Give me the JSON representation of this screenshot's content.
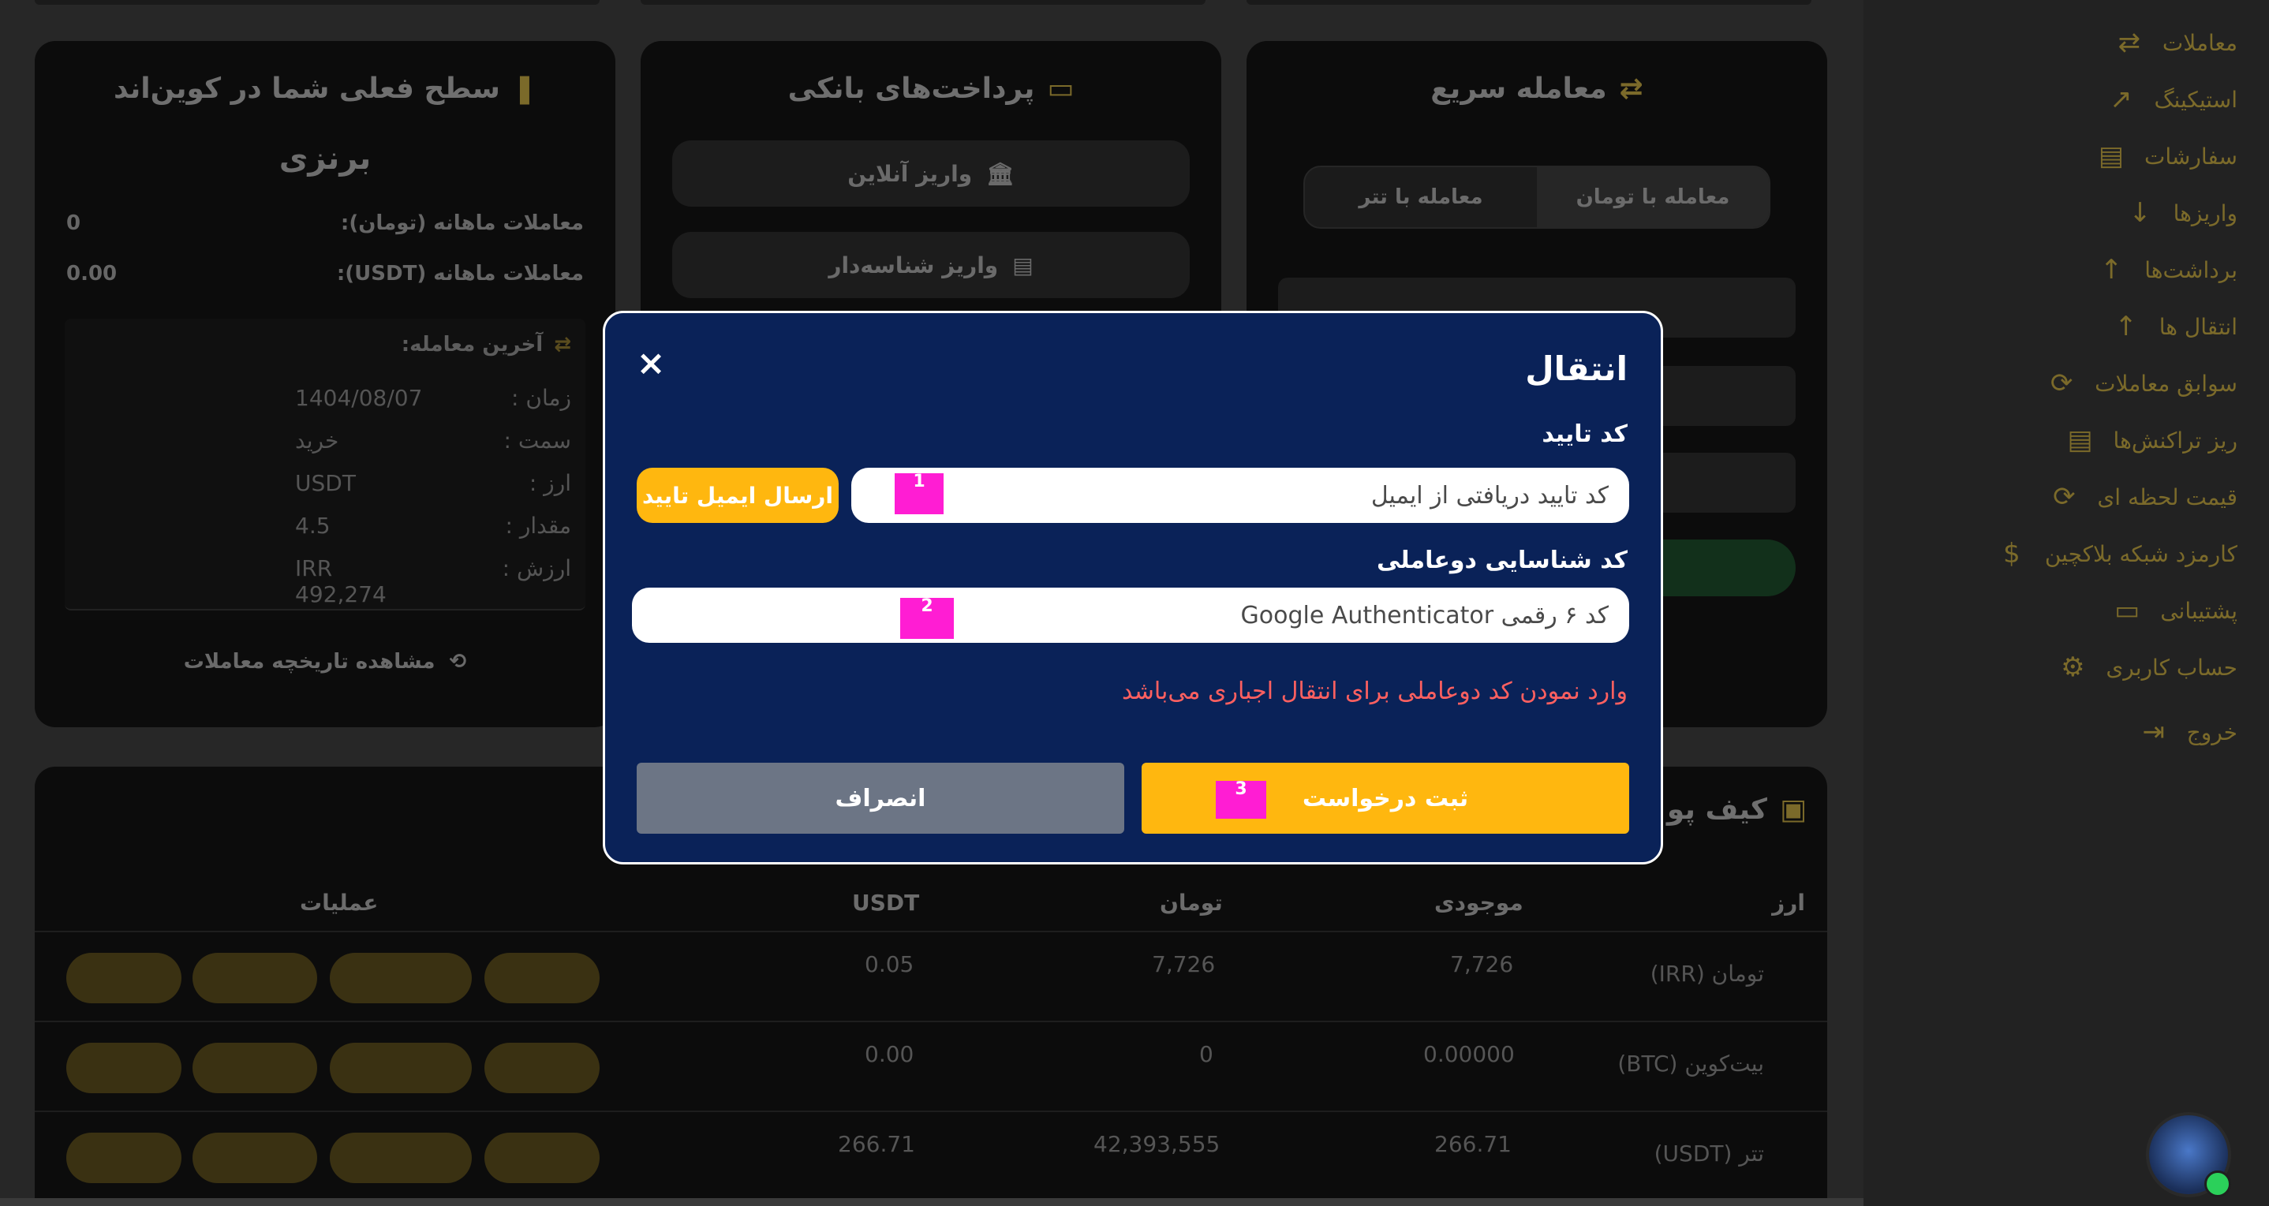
{
  "sidebar": {
    "items": [
      {
        "label": "معاملات",
        "icon": "swap-icon"
      },
      {
        "label": "استیکینگ",
        "icon": "chart-icon"
      },
      {
        "label": "سفارشات",
        "icon": "list-icon"
      },
      {
        "label": "واریزها",
        "icon": "arrow-down-icon"
      },
      {
        "label": "برداشت‌ها",
        "icon": "arrow-up-icon"
      },
      {
        "label": "انتقال ها",
        "icon": "arrow-up-icon"
      },
      {
        "label": "سوابق معاملات",
        "icon": "refresh-icon"
      },
      {
        "label": "ریز تراکنش‌ها",
        "icon": "list-icon"
      },
      {
        "label": "قیمت لحظه ای",
        "icon": "refresh-icon"
      },
      {
        "label": "کارمزد شبکه بلاکچین",
        "icon": "dollar-icon"
      },
      {
        "label": "پشتیبانی",
        "icon": "chat-icon"
      },
      {
        "label": "حساب کاربری",
        "icon": "gear-icon"
      },
      {
        "label": "خروج",
        "icon": "logout-icon"
      }
    ]
  },
  "quick_trade": {
    "title": "معامله سریع",
    "tab_toman": "معامله با تومان",
    "tab_tether": "معامله با تتر"
  },
  "bank": {
    "title": "پرداخت‌های بانکی",
    "online_deposit": "واریز آنلاین",
    "id_deposit": "واریز شناسه‌دار"
  },
  "level": {
    "title": "سطح فعلی شما در کوین‌اند",
    "name": "برنزی",
    "monthly_toman_label": "معاملات ماهانه (تومان):",
    "monthly_toman_value": "0",
    "monthly_usdt_label": "معاملات ماهانه (USDT):",
    "monthly_usdt_value": "0.00",
    "last_trade_title": "آخرین معامله:",
    "last_trade": [
      {
        "k": "زمان :",
        "v": "1404/08/07"
      },
      {
        "k": "سمت :",
        "v": "خرید"
      },
      {
        "k": "ارز :",
        "v": "USDT"
      },
      {
        "k": "مقدار :",
        "v": "4.5"
      },
      {
        "k": "ارزش :",
        "v": "IRR 492,274"
      }
    ],
    "history_link": "مشاهده تاریخچه معاملات"
  },
  "wallet": {
    "title": "کیف پو",
    "columns": {
      "currency": "ارز",
      "balance": "موجودی",
      "toman": "تومان",
      "usdt": "USDT",
      "actions": "عملیات"
    },
    "rows": [
      {
        "currency": "تومان (IRR)",
        "balance": "7,726",
        "toman": "7,726",
        "usdt": "0.05"
      },
      {
        "currency": "بیت‌کوین (BTC)",
        "balance": "0.00000",
        "toman": "0",
        "usdt": "0.00"
      },
      {
        "currency": "تتر (USDT)",
        "balance": "266.71",
        "toman": "42,393,555",
        "usdt": "266.71"
      }
    ]
  },
  "modal": {
    "title": "انتقال",
    "close_icon": "×",
    "verify_label": "کد تایید",
    "verify_placeholder": "کد تایید دریافتی از ایمیل",
    "send_email_button": "ارسال ایمیل تایید",
    "twofa_label": "کد شناسایی دوعاملی",
    "twofa_placeholder": "کد ۶ رقمی Google Authenticator",
    "error_text": "وارد نمودن کد دوعاملی برای انتقال اجباری می‌باشد",
    "submit_button": "ثبت درخواست",
    "cancel_button": "انصراف"
  },
  "badges": {
    "b1": "1",
    "b2": "2",
    "b3": "3"
  },
  "colors": {
    "modal_bg": "#0a2258",
    "accent": "#ffb70f",
    "error": "#ff6060",
    "cancel": "#6c7585",
    "badge": "#ff1dd3"
  }
}
